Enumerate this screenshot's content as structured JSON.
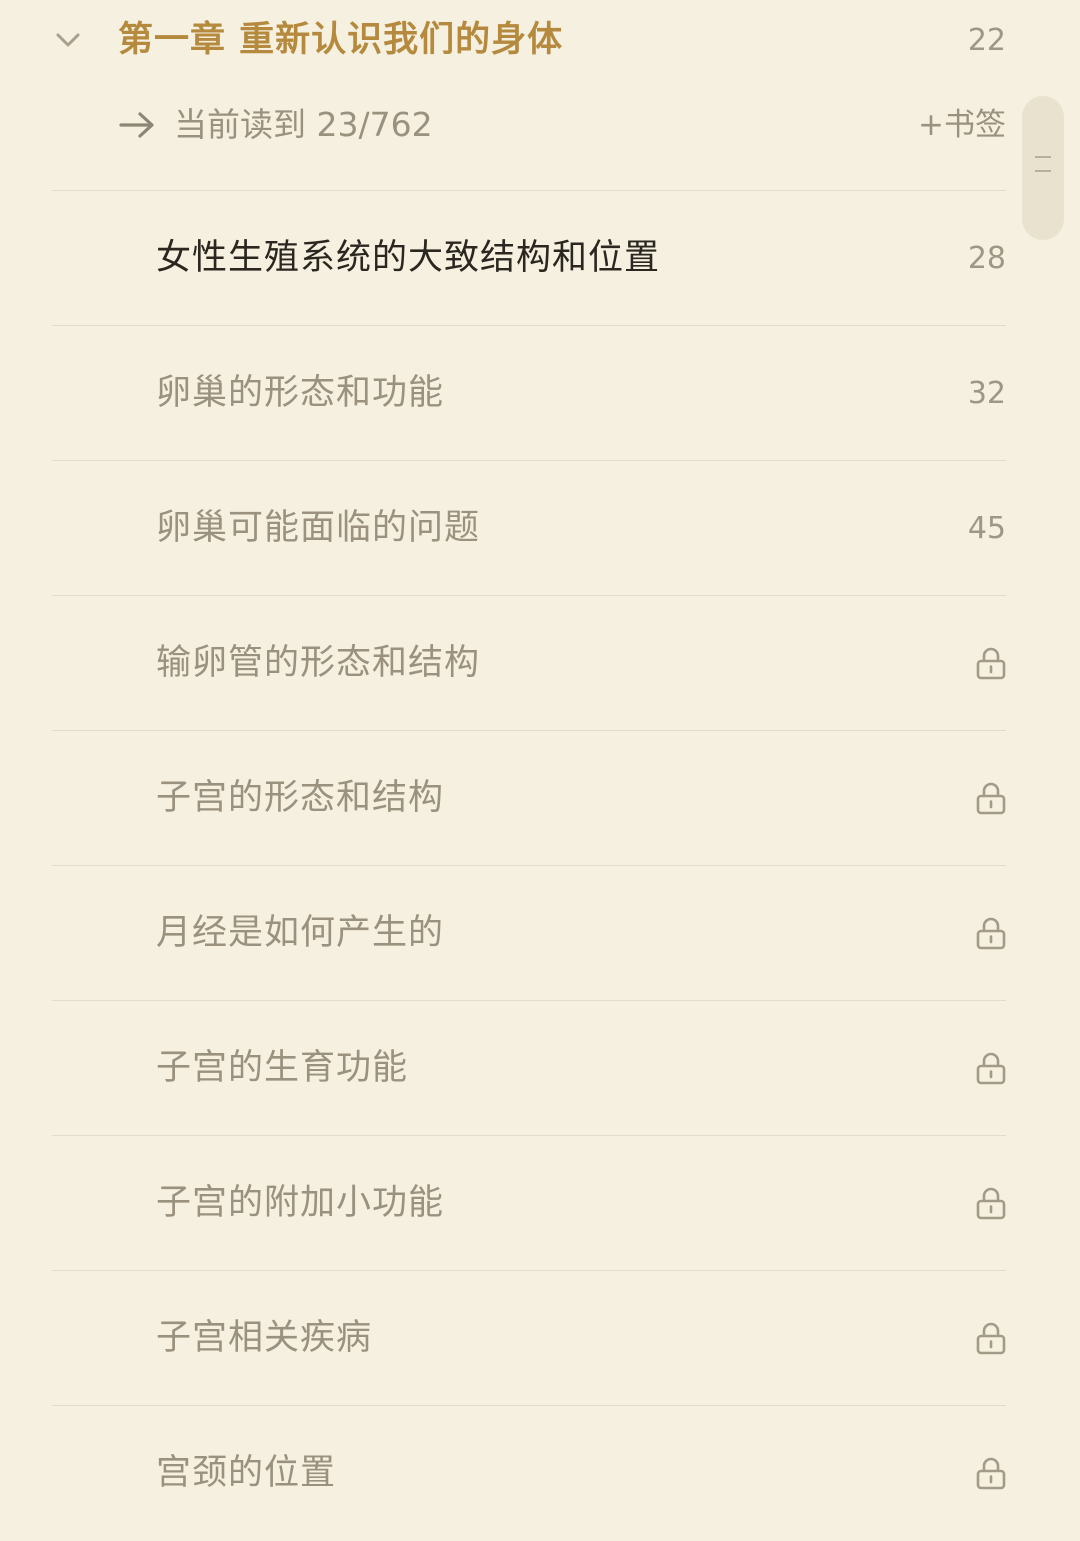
{
  "chapter": {
    "title": "第一章 重新认识我们的身体",
    "page": "22",
    "expand_icon": "chevron-down-icon"
  },
  "progress": {
    "icon": "arrow-right-icon",
    "text": "当前读到 23/762",
    "bookmark_label": "+书签"
  },
  "sections": [
    {
      "title": "女性生殖系统的大致结构和位置",
      "page": "28",
      "locked": false,
      "active": true
    },
    {
      "title": "卵巢的形态和功能",
      "page": "32",
      "locked": false,
      "active": false
    },
    {
      "title": "卵巢可能面临的问题",
      "page": "45",
      "locked": false,
      "active": false
    },
    {
      "title": "输卵管的形态和结构",
      "page": "",
      "locked": true,
      "active": false
    },
    {
      "title": "子宫的形态和结构",
      "page": "",
      "locked": true,
      "active": false
    },
    {
      "title": "月经是如何产生的",
      "page": "",
      "locked": true,
      "active": false
    },
    {
      "title": "子宫的生育功能",
      "page": "",
      "locked": true,
      "active": false
    },
    {
      "title": "子宫的附加小功能",
      "page": "",
      "locked": true,
      "active": false
    },
    {
      "title": "子宫相关疾病",
      "page": "",
      "locked": true,
      "active": false
    },
    {
      "title": "宫颈的位置",
      "page": "",
      "locked": true,
      "active": false
    }
  ],
  "colors": {
    "background": "#f5f0df",
    "chapter_accent": "#b58a3e",
    "active_text": "#2b2720",
    "muted_text": "#9a917e",
    "divider": "#e3dcc8"
  }
}
